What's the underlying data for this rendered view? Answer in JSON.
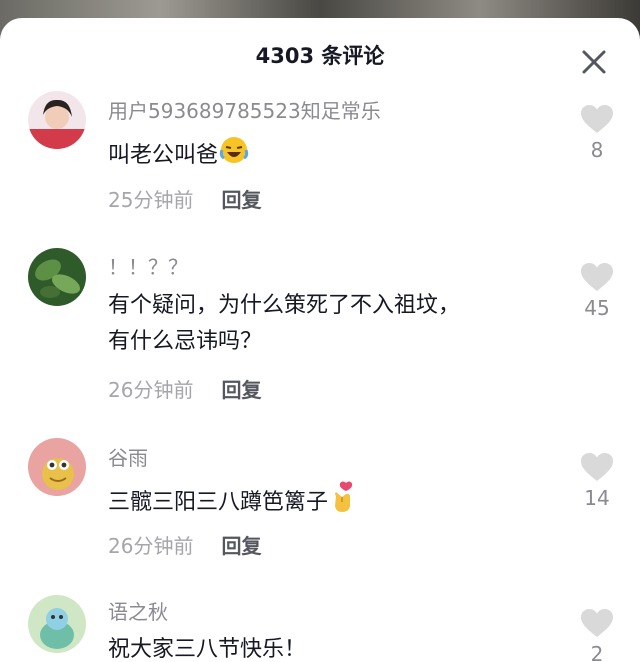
{
  "header": {
    "title": "4303 条评论",
    "close_icon": "close-icon"
  },
  "comments": [
    {
      "username": "用户593689785523知足常乐",
      "lines": [
        "叫老公叫爸"
      ],
      "emoji": "laughing-crying-emoji",
      "time": "25分钟前",
      "reply_label": "回复",
      "likes": "8"
    },
    {
      "username": "！！？？",
      "lines": [
        "有个疑问，为什么策死了不入祖坟，",
        "有什么忌讳吗？"
      ],
      "time": "26分钟前",
      "reply_label": "回复",
      "likes": "45"
    },
    {
      "username": "谷雨",
      "lines": [
        "三髋三阳三八蹲笆篱子"
      ],
      "emoji": "finger-heart-emoji",
      "time": "26分钟前",
      "reply_label": "回复",
      "likes": "14"
    },
    {
      "username": "语之秋",
      "lines": [
        "祝大家三八节快乐！"
      ],
      "likes": "2"
    }
  ],
  "colors": {
    "like_icon": "#d9d9d9",
    "username": "#8a8b91",
    "text": "#161823"
  }
}
